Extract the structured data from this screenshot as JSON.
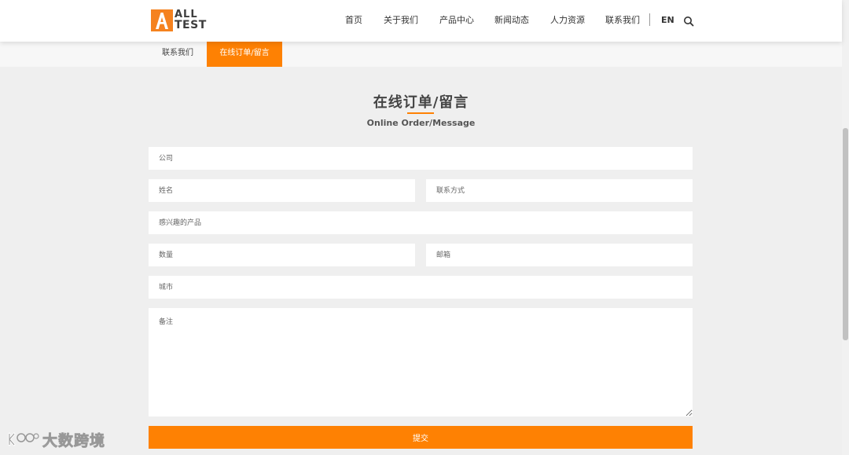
{
  "logo": {
    "line1": "ALL",
    "line2": "TEST",
    "brand_color": "#f5821f"
  },
  "nav": {
    "items": [
      {
        "label": "首页"
      },
      {
        "label": "关于我们"
      },
      {
        "label": "产品中心"
      },
      {
        "label": "新闻动态"
      },
      {
        "label": "人力资源"
      },
      {
        "label": "联系我们"
      }
    ],
    "lang": "EN",
    "search_icon": "search-icon"
  },
  "subnav": {
    "tabs": [
      {
        "label": "联系我们",
        "active": false
      },
      {
        "label": "在线订单/留言",
        "active": true
      }
    ]
  },
  "section": {
    "title": "在线订单/留言",
    "subtitle": "Online Order/Message"
  },
  "form": {
    "company": "公司",
    "name": "姓名",
    "contact": "联系方式",
    "product": "感兴趣的产品",
    "quantity": "数量",
    "email": "邮箱",
    "city": "城市",
    "notes": "备注",
    "submit_label": "提交"
  },
  "accent_color": "#fe8103",
  "watermark": {
    "text": "大数跨境"
  }
}
